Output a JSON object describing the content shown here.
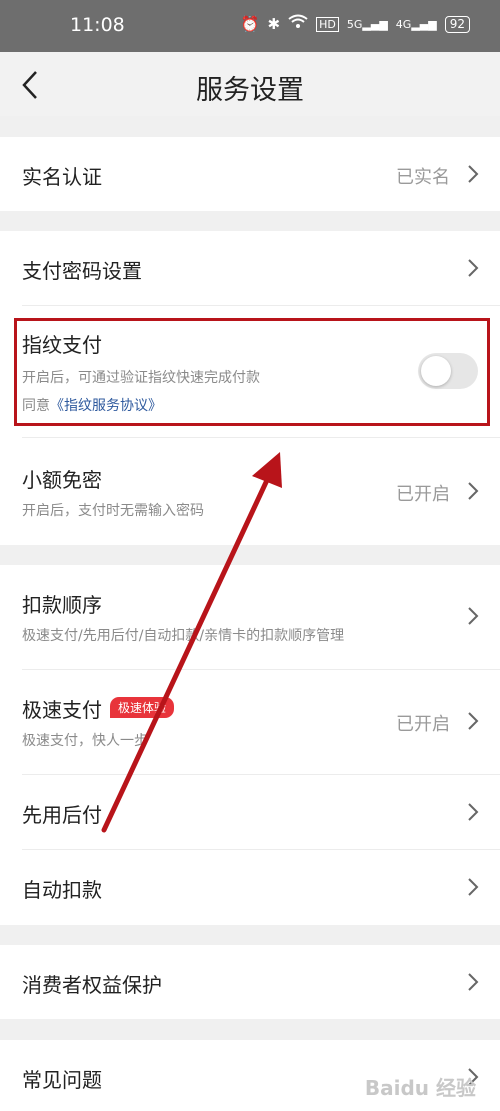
{
  "status_bar": {
    "time": "11:08",
    "network_labels": [
      "HD",
      "5G",
      "4G"
    ],
    "battery": "92"
  },
  "header": {
    "title": "服务设置"
  },
  "items": {
    "real_name": {
      "label": "实名认证",
      "value": "已实名"
    },
    "pay_password": {
      "label": "支付密码设置"
    },
    "fingerprint": {
      "label": "指纹支付",
      "description": "开启后，可通过验证指纹快速完成付款",
      "agree_prefix": "同意",
      "agreement_link": "《指纹服务协议》",
      "enabled": false
    },
    "small_free": {
      "label": "小额免密",
      "description": "开启后，支付时无需输入密码",
      "value": "已开启"
    },
    "deduct_order": {
      "label": "扣款顺序",
      "description": "极速支付/先用后付/自动扣款/亲情卡的扣款顺序管理"
    },
    "fast_pay": {
      "label": "极速支付",
      "badge": "极速体验",
      "description": "极速支付，快人一步",
      "value": "已开启"
    },
    "pay_later": {
      "label": "先用后付"
    },
    "auto_deduct": {
      "label": "自动扣款"
    },
    "consumer_rights": {
      "label": "消费者权益保护"
    },
    "faq": {
      "label": "常见问题"
    }
  },
  "watermark": "Baidu 经验",
  "colors": {
    "highlight": "#b8141a",
    "badge": "#e8343b",
    "link": "#2f5a9e"
  }
}
